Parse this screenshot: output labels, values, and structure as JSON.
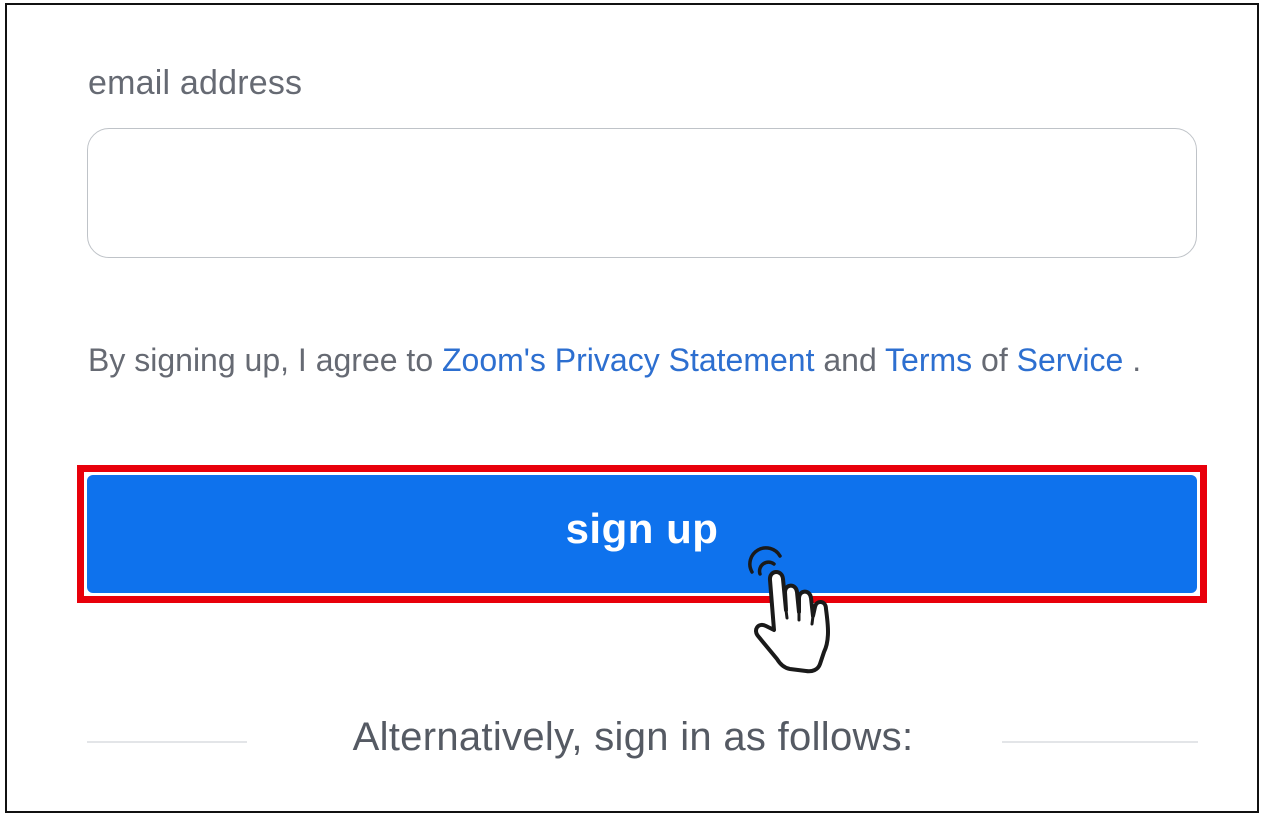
{
  "form": {
    "email_label": "email address",
    "email_value": "",
    "email_placeholder": ""
  },
  "terms": {
    "prefix": "By signing up, I agree to ",
    "privacy_link": "Zoom's Privacy Statement",
    "middle": " and ",
    "terms_link": "Terms",
    "of_text": " of ",
    "service_link": "Service",
    "suffix": " ."
  },
  "signup": {
    "label": "sign up"
  },
  "alternative": {
    "label": "Alternatively, sign in as follows:"
  },
  "colors": {
    "button": "#0e72ed",
    "link": "#2d6fd0",
    "highlight": "#e8000b",
    "text": "#666a73"
  },
  "icons": {
    "pointer": "pointing-hand-icon"
  }
}
